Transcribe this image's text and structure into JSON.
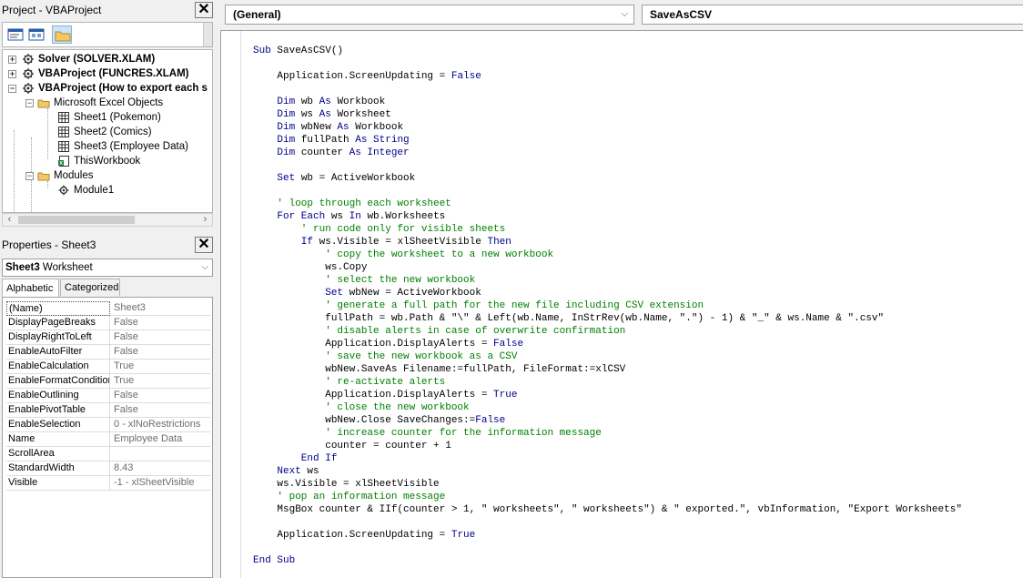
{
  "project_pane": {
    "title": "Project - VBAProject",
    "close_label": "✕",
    "toolbar_icons": [
      "view-code-icon",
      "view-object-icon",
      "toggle-folders-icon"
    ],
    "tree": [
      {
        "label": "Solver (SOLVER.XLAM)",
        "icon": "vba-project-icon",
        "expander": "+",
        "bold": true
      },
      {
        "label": "VBAProject (FUNCRES.XLAM)",
        "icon": "vba-project-icon",
        "expander": "+",
        "bold": true
      },
      {
        "label": "VBAProject (How to export each s",
        "icon": "vba-project-icon",
        "expander": "−",
        "bold": true
      },
      {
        "label": "Microsoft Excel Objects",
        "icon": "folder-icon",
        "expander": "−",
        "bold": false
      },
      {
        "label": "Sheet1 (Pokemon)",
        "icon": "sheet-icon",
        "bold": false
      },
      {
        "label": "Sheet2 (Comics)",
        "icon": "sheet-icon",
        "bold": false
      },
      {
        "label": "Sheet3 (Employee Data)",
        "icon": "sheet-icon",
        "bold": false
      },
      {
        "label": "ThisWorkbook",
        "icon": "workbook-icon",
        "bold": false
      },
      {
        "label": "Modules",
        "icon": "folder-icon",
        "expander": "−",
        "bold": false
      },
      {
        "label": "Module1",
        "icon": "module-icon",
        "bold": false
      }
    ]
  },
  "properties_pane": {
    "title": "Properties - Sheet3",
    "close_label": "✕",
    "object_name": "Sheet3",
    "object_type": "Worksheet",
    "tabs": [
      "Alphabetic",
      "Categorized"
    ],
    "rows": [
      {
        "name": "(Name)",
        "value": "Sheet3"
      },
      {
        "name": "DisplayPageBreaks",
        "value": "False"
      },
      {
        "name": "DisplayRightToLeft",
        "value": "False"
      },
      {
        "name": "EnableAutoFilter",
        "value": "False"
      },
      {
        "name": "EnableCalculation",
        "value": "True"
      },
      {
        "name": "EnableFormatConditions",
        "value": "True"
      },
      {
        "name": "EnableOutlining",
        "value": "False"
      },
      {
        "name": "EnablePivotTable",
        "value": "False"
      },
      {
        "name": "EnableSelection",
        "value": "0 - xlNoRestrictions"
      },
      {
        "name": "Name",
        "value": "Employee Data"
      },
      {
        "name": "ScrollArea",
        "value": ""
      },
      {
        "name": "StandardWidth",
        "value": "8.43"
      },
      {
        "name": "Visible",
        "value": "-1 - xlSheetVisible"
      }
    ]
  },
  "code_pane": {
    "object_combo": "(General)",
    "procedure_combo": "SaveAsCSV",
    "lines": [
      [
        [
          "kw",
          "Sub "
        ],
        [
          "tx",
          "SaveAsCSV()"
        ]
      ],
      [],
      [
        [
          "tx",
          "    Application.ScreenUpdating = "
        ],
        [
          "kw",
          "False"
        ]
      ],
      [],
      [
        [
          "kw",
          "    Dim "
        ],
        [
          "tx",
          "wb "
        ],
        [
          "kw",
          "As "
        ],
        [
          "tx",
          "Workbook"
        ]
      ],
      [
        [
          "kw",
          "    Dim "
        ],
        [
          "tx",
          "ws "
        ],
        [
          "kw",
          "As "
        ],
        [
          "tx",
          "Worksheet"
        ]
      ],
      [
        [
          "kw",
          "    Dim "
        ],
        [
          "tx",
          "wbNew "
        ],
        [
          "kw",
          "As "
        ],
        [
          "tx",
          "Workbook"
        ]
      ],
      [
        [
          "kw",
          "    Dim "
        ],
        [
          "tx",
          "fullPath "
        ],
        [
          "kw",
          "As String"
        ]
      ],
      [
        [
          "kw",
          "    Dim "
        ],
        [
          "tx",
          "counter "
        ],
        [
          "kw",
          "As Integer"
        ]
      ],
      [],
      [
        [
          "kw",
          "    Set "
        ],
        [
          "tx",
          "wb = ActiveWorkbook"
        ]
      ],
      [],
      [
        [
          "cm",
          "    ' loop through each worksheet"
        ]
      ],
      [
        [
          "kw",
          "    For Each "
        ],
        [
          "tx",
          "ws "
        ],
        [
          "kw",
          "In "
        ],
        [
          "tx",
          "wb.Worksheets"
        ]
      ],
      [
        [
          "cm",
          "        ' run code only for visible sheets"
        ]
      ],
      [
        [
          "kw",
          "        If "
        ],
        [
          "tx",
          "ws.Visible = xlSheetVisible "
        ],
        [
          "kw",
          "Then"
        ]
      ],
      [
        [
          "cm",
          "            ' copy the worksheet to a new workbook"
        ]
      ],
      [
        [
          "tx",
          "            ws.Copy"
        ]
      ],
      [
        [
          "cm",
          "            ' select the new workbook"
        ]
      ],
      [
        [
          "kw",
          "            Set "
        ],
        [
          "tx",
          "wbNew = ActiveWorkbook"
        ]
      ],
      [
        [
          "cm",
          "            ' generate a full path for the new file including CSV extension"
        ]
      ],
      [
        [
          "tx",
          "            fullPath = wb.Path & \"\\\" & Left(wb.Name, InStrRev(wb.Name, \".\") - 1) & \"_\" & ws.Name & \".csv\""
        ]
      ],
      [
        [
          "cm",
          "            ' disable alerts in case of overwrite confirmation"
        ]
      ],
      [
        [
          "tx",
          "            Application.DisplayAlerts = "
        ],
        [
          "kw",
          "False"
        ]
      ],
      [
        [
          "cm",
          "            ' save the new workbook as a CSV"
        ]
      ],
      [
        [
          "tx",
          "            wbNew.SaveAs Filename:=fullPath, FileFormat:=xlCSV"
        ]
      ],
      [
        [
          "cm",
          "            ' re-activate alerts"
        ]
      ],
      [
        [
          "tx",
          "            Application.DisplayAlerts = "
        ],
        [
          "kw",
          "True"
        ]
      ],
      [
        [
          "cm",
          "            ' close the new workbook"
        ]
      ],
      [
        [
          "tx",
          "            wbNew.Close SaveChanges:="
        ],
        [
          "kw",
          "False"
        ]
      ],
      [
        [
          "cm",
          "            ' increase counter for the information message"
        ]
      ],
      [
        [
          "tx",
          "            counter = counter + 1"
        ]
      ],
      [
        [
          "kw",
          "        End If"
        ]
      ],
      [
        [
          "kw",
          "    Next "
        ],
        [
          "tx",
          "ws"
        ]
      ],
      [
        [
          "tx",
          "    ws.Visible = xlSheetVisible"
        ]
      ],
      [
        [
          "cm",
          "    ' pop an information message"
        ]
      ],
      [
        [
          "tx",
          "    MsgBox counter & IIf(counter > 1, \" worksheets\", \" worksheets\") & \" exported.\", vbInformation, \"Export Worksheets\""
        ]
      ],
      [],
      [
        [
          "tx",
          "    Application.ScreenUpdating = "
        ],
        [
          "kw",
          "True"
        ]
      ],
      [],
      [
        [
          "kw",
          "End Sub"
        ]
      ]
    ]
  },
  "colors": {
    "keyword": "#00008b",
    "comment": "#008000",
    "text": "#000000"
  }
}
